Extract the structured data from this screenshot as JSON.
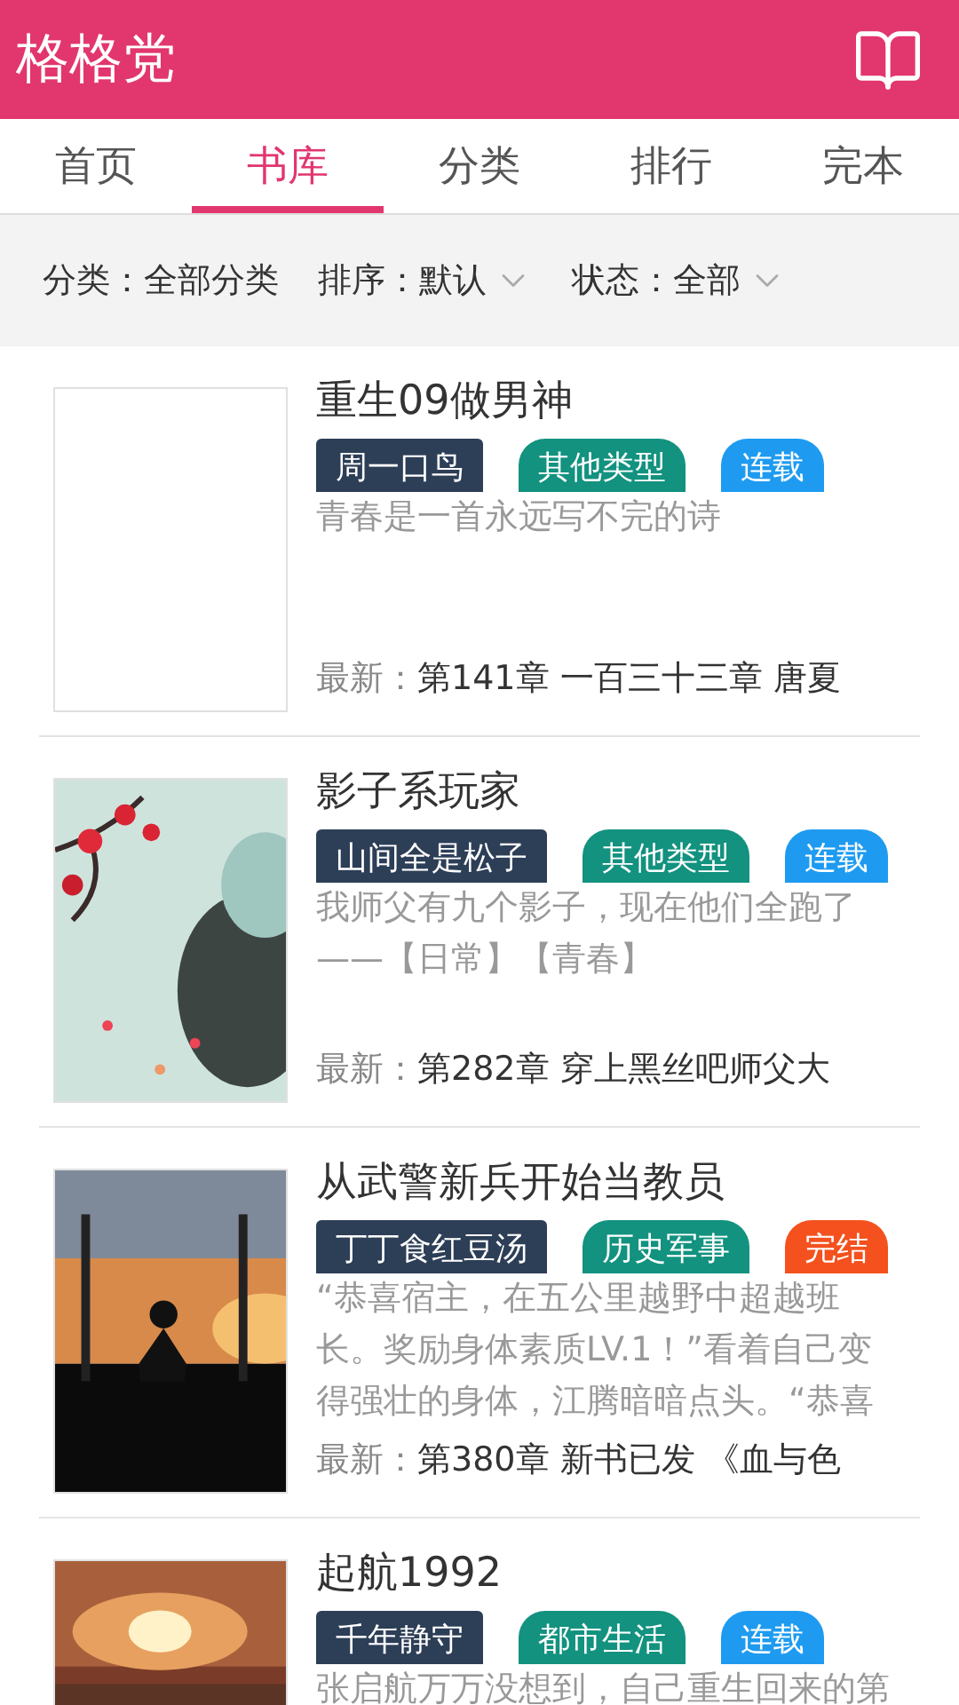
{
  "app_bar": {
    "title": "格格党"
  },
  "tabs": [
    {
      "label": "首页",
      "selected": false
    },
    {
      "label": "书库",
      "selected": true
    },
    {
      "label": "分类",
      "selected": false
    },
    {
      "label": "排行",
      "selected": false
    },
    {
      "label": "完本",
      "selected": false
    }
  ],
  "filters": [
    {
      "label": "分类：",
      "value": "全部分类",
      "dropdown": false
    },
    {
      "label": "排序：",
      "value": "默认",
      "dropdown": true
    },
    {
      "label": "状态：",
      "value": "全部",
      "dropdown": true
    }
  ],
  "books": [
    {
      "title": "重生09做男神",
      "cover": {
        "kind": "blank"
      },
      "author": "周一口鸟",
      "category": "其他类型",
      "status": {
        "label": "连载",
        "color": "#1e9bf0"
      },
      "description": [
        "青春是一首永远写不完的诗"
      ],
      "latest_label": "最新：",
      "latest": "第141章 一百三十三章 唐夏"
    },
    {
      "title": "影子系玩家",
      "cover": {
        "kind": "picture"
      },
      "author": "山间全是松子",
      "category": "其他类型",
      "status": {
        "label": "连载",
        "color": "#1e9bf0"
      },
      "description": [
        "我师父有九个影子，现在他们全跑了",
        "——【日常】【青春】"
      ],
      "latest_label": "最新：",
      "latest": "第282章 穿上黑丝吧师父大"
    },
    {
      "title": "从武警新兵开始当教员",
      "cover": {
        "kind": "picture"
      },
      "author": "丁丁食红豆汤",
      "category": "历史军事",
      "status": {
        "label": "完结",
        "color": "#f4511e"
      },
      "description": [
        "“恭喜宿主，在五公里越野中超越班",
        "长。奖励身体素质LV.1！”看着自己变",
        "得强壮的身体，江腾暗暗点头。“恭喜"
      ],
      "latest_label": "最新：",
      "latest": "第380章 新书已发 《血与色"
    },
    {
      "title": "起航1992",
      "cover": {
        "kind": "picture"
      },
      "author": "千年静守",
      "category": "都市生活",
      "status": {
        "label": "连载",
        "color": "#1e9bf0"
      },
      "description": [
        "张启航万万没想到，自己重生回来的第"
      ]
    }
  ]
}
